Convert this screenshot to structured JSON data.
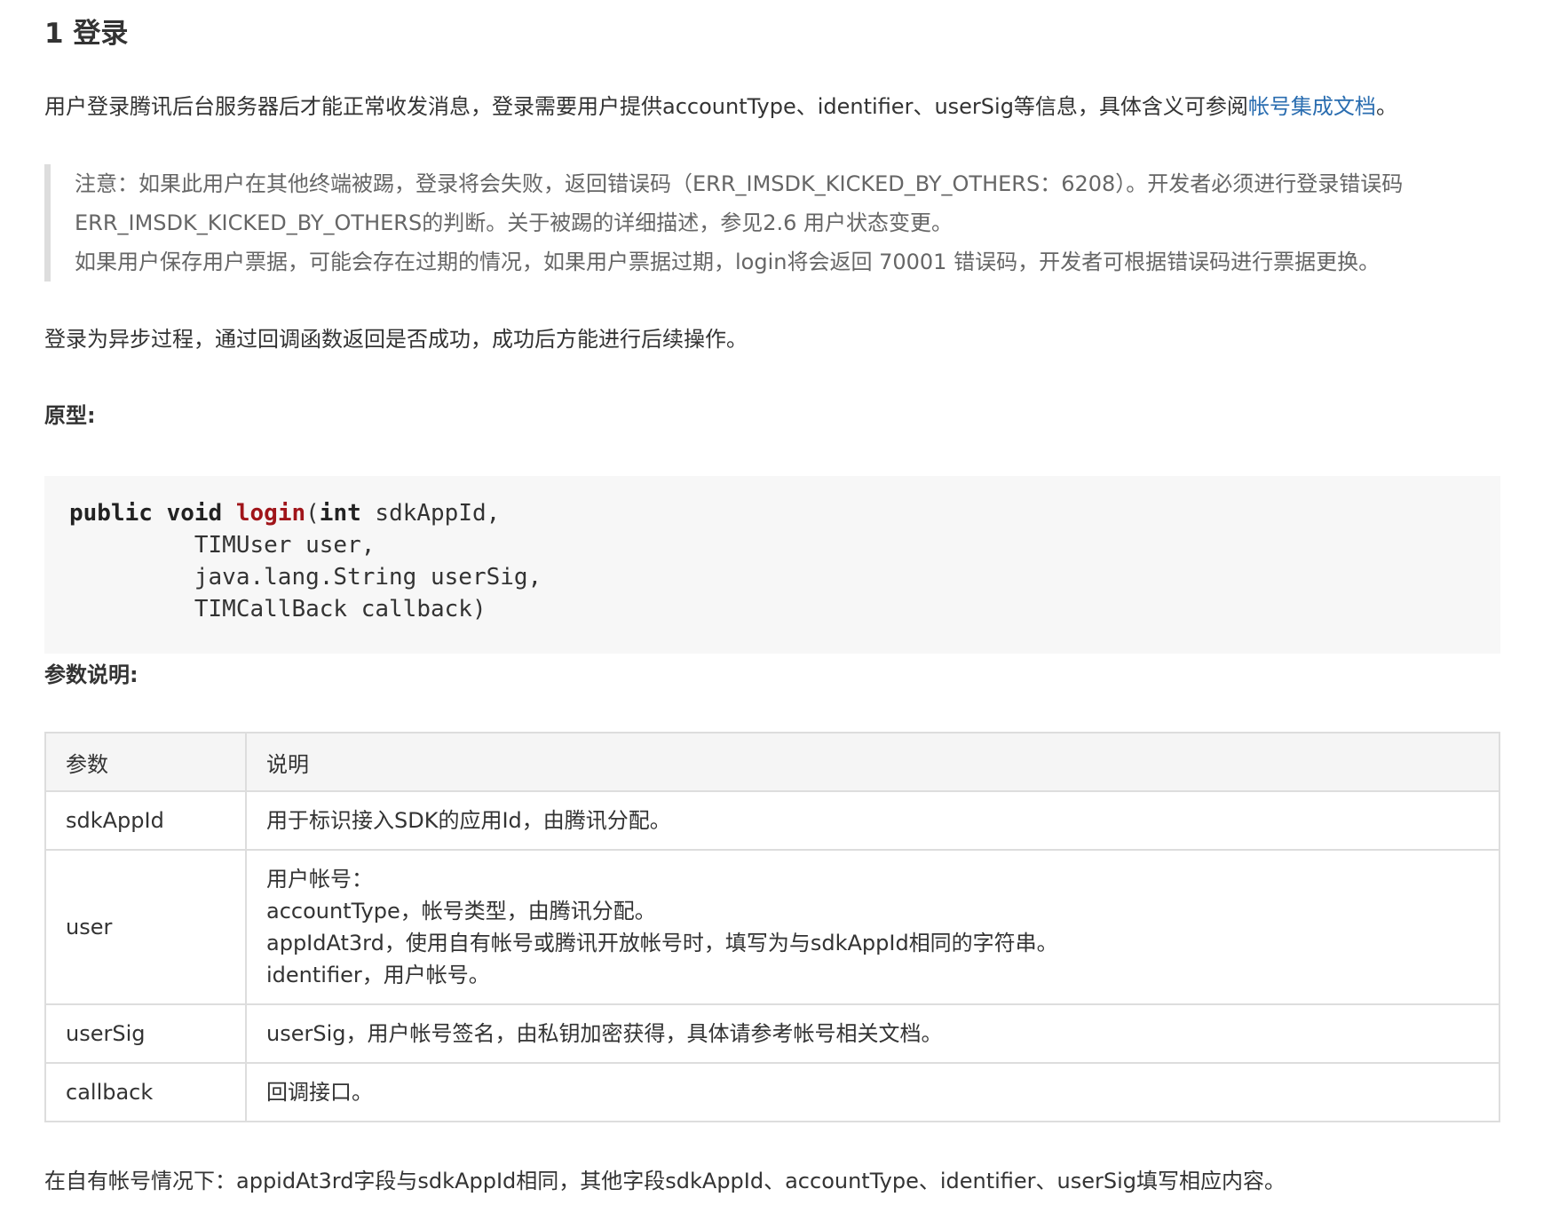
{
  "section": {
    "title": "1 登录"
  },
  "intro": {
    "text": "用户登录腾讯后台服务器后才能正常收发消息，登录需要用户提供accountType、identifier、userSig等信息，具体含义可参阅",
    "link_text": "帐号集成文档",
    "end": "。"
  },
  "note": {
    "lines": [
      "注意：如果此用户在其他终端被踢，登录将会失败，返回错误码（ERR_IMSDK_KICKED_BY_OTHERS：6208）。开发者必须进行登录错误码",
      "ERR_IMSDK_KICKED_BY_OTHERS的判断。关于被踢的详细描述，参见2.6 用户状态变更。",
      "如果用户保存用户票据，可能会存在过期的情况，如果用户票据过期，login将会返回 70001 错误码，开发者可根据错误码进行票据更换。"
    ]
  },
  "async_text": "登录为异步过程，通过回调函数返回是否成功，成功后方能进行后续操作。",
  "prototype_label": "原型:",
  "code": {
    "kw_public": "public",
    "kw_void": "void",
    "fn_name": "login",
    "open": "(",
    "kw_int": "int",
    "rest_line1": " sdkAppId,",
    "line2": "         TIMUser user,",
    "line3": "         java.lang.String userSig,",
    "line4": "         TIMCallBack callback)"
  },
  "params_label": "参数说明:",
  "table": {
    "headers": [
      "参数",
      "说明"
    ],
    "rows": [
      {
        "param": "sdkAppId",
        "desc": [
          "用于标识接入SDK的应用Id，由腾讯分配。"
        ]
      },
      {
        "param": "user",
        "desc": [
          "用户帐号：",
          "accountType，帐号类型，由腾讯分配。",
          "appIdAt3rd，使用自有帐号或腾讯开放帐号时，填写为与sdkAppId相同的字符串。",
          "identifier，用户帐号。"
        ]
      },
      {
        "param": "userSig",
        "desc": [
          "userSig，用户帐号签名，由私钥加密获得，具体请参考帐号相关文档。"
        ]
      },
      {
        "param": "callback",
        "desc": [
          "回调接口。"
        ]
      }
    ]
  },
  "footer_text": "在自有帐号情况下：appidAt3rd字段与sdkAppId相同，其他字段sdkAppId、accountType、identifier、userSig填写相应内容。",
  "colors": {
    "link": "#2a6db0",
    "function_name": "#a0151a",
    "code_bg": "#f7f7f7",
    "border": "#dddddd"
  }
}
